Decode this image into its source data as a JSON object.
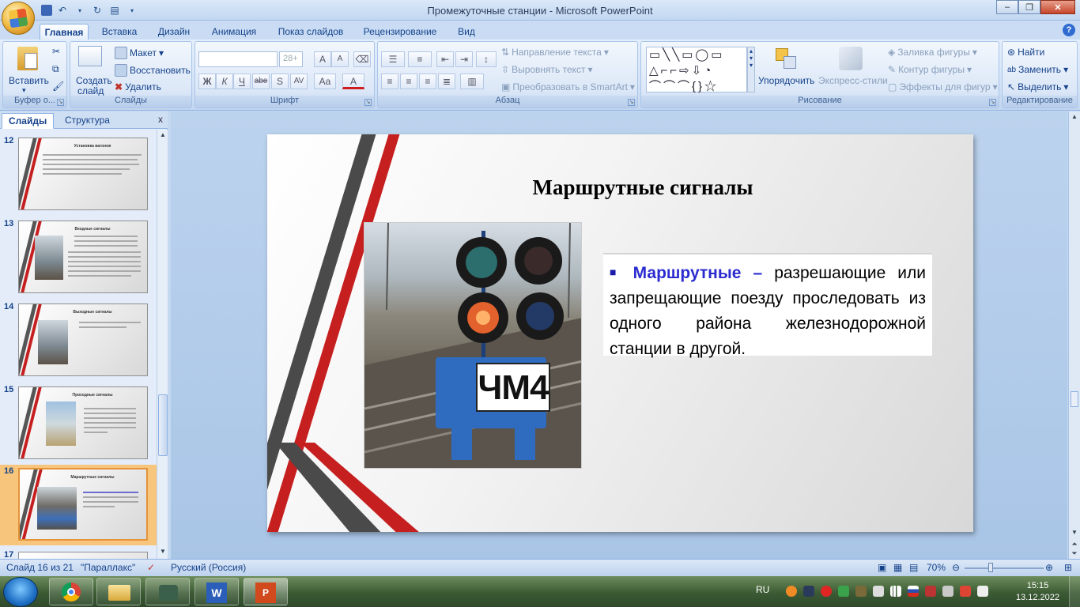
{
  "window": {
    "title": "Промежуточные станции - Microsoft PowerPoint"
  },
  "ribbon_tabs": [
    "Главная",
    "Вставка",
    "Дизайн",
    "Анимация",
    "Показ слайдов",
    "Рецензирование",
    "Вид"
  ],
  "groups": {
    "clipboard": {
      "name": "Буфер о...",
      "paste": "Вставить"
    },
    "slides": {
      "name": "Слайды",
      "new_slide_1": "Создать",
      "new_slide_2": "слайд",
      "layout": "Макет",
      "reset": "Восстановить",
      "delete": "Удалить"
    },
    "font": {
      "name": "Шрифт",
      "size_placeholder": "28+",
      "bold": "Ж",
      "italic": "К",
      "underline": "Ч",
      "strike": "abe",
      "shadow": "S",
      "spacing": "AV",
      "case": "Aa",
      "color": "A",
      "grow": "A",
      "shrink": "A"
    },
    "paragraph": {
      "name": "Абзац",
      "text_direction": "Направление текста",
      "align_text": "Выровнять текст",
      "smartart": "Преобразовать в SmartArt"
    },
    "drawing": {
      "name": "Рисование",
      "arrange": "Упорядочить",
      "quick_styles": "Экспресс-стили",
      "fill": "Заливка фигуры",
      "outline": "Контур фигуры",
      "effects": "Эффекты для фигур"
    },
    "editing": {
      "name": "Редактирование",
      "find": "Найти",
      "replace": "Заменить",
      "select": "Выделить"
    }
  },
  "panel": {
    "tab_slides": "Слайды",
    "tab_outline": "Структура",
    "close": "x"
  },
  "thumbnails": [
    {
      "num": "12",
      "title": "Установка вагонов"
    },
    {
      "num": "13",
      "title": "Входные сигналы"
    },
    {
      "num": "14",
      "title": "Выходные сигналы"
    },
    {
      "num": "15",
      "title": "Проходные сигналы"
    },
    {
      "num": "16",
      "title": "Маршрутные сигналы"
    },
    {
      "num": "17",
      "title": ""
    }
  ],
  "slide": {
    "title": "Маршрутные сигналы",
    "photo_label": "ЧМ4",
    "bullet": "■",
    "term": "Маршрутные",
    "dash": " – ",
    "body": "разрешающие или запрещающие поезду проследовать из одного района железнодорожной станции в другой."
  },
  "status": {
    "slide": "Слайд 16 из 21",
    "theme": "\"Параллакс\"",
    "language": "Русский (Россия)",
    "zoom": "70%"
  },
  "taskbar": {
    "lang": "RU",
    "time": "15:15",
    "date": "13.12.2022"
  },
  "colors": {
    "accent_red": "#c61f1f",
    "stripe_gray": "#4a4a4a",
    "term_blue": "#2b2bd0",
    "ribbon_text": "#15428b"
  }
}
